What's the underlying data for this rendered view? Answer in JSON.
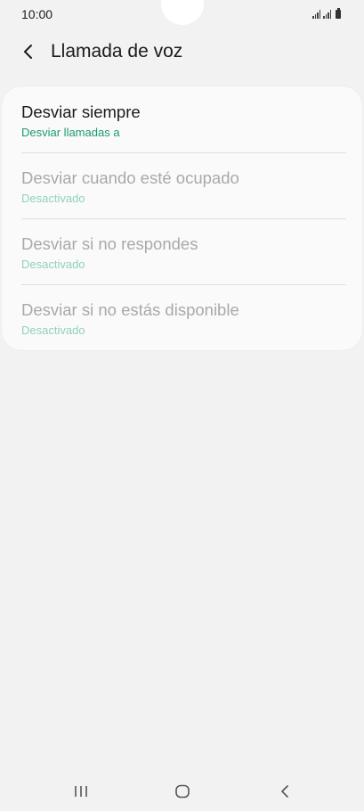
{
  "status_bar": {
    "time": "10:00",
    "icons": [
      "signal-icon",
      "signal-icon",
      "battery-icon"
    ]
  },
  "header": {
    "back_icon": "chevron-left-icon",
    "title": "Llamada de voz"
  },
  "options": [
    {
      "title": "Desviar siempre",
      "subtitle": "Desviar llamadas a",
      "enabled": true
    },
    {
      "title": "Desviar cuando esté ocupado",
      "subtitle": "Desactivado",
      "enabled": false
    },
    {
      "title": "Desviar si no respondes",
      "subtitle": "Desactivado",
      "enabled": false
    },
    {
      "title": "Desviar si no estás disponible",
      "subtitle": "Desactivado",
      "enabled": false
    }
  ],
  "navigation": {
    "icons": [
      "recent-apps-icon",
      "home-icon",
      "back-icon"
    ]
  },
  "colors": {
    "accent": "#1a9b6b",
    "accent_disabled": "#8fd3b9",
    "background": "#f2f2f2",
    "card": "#fafafa"
  }
}
